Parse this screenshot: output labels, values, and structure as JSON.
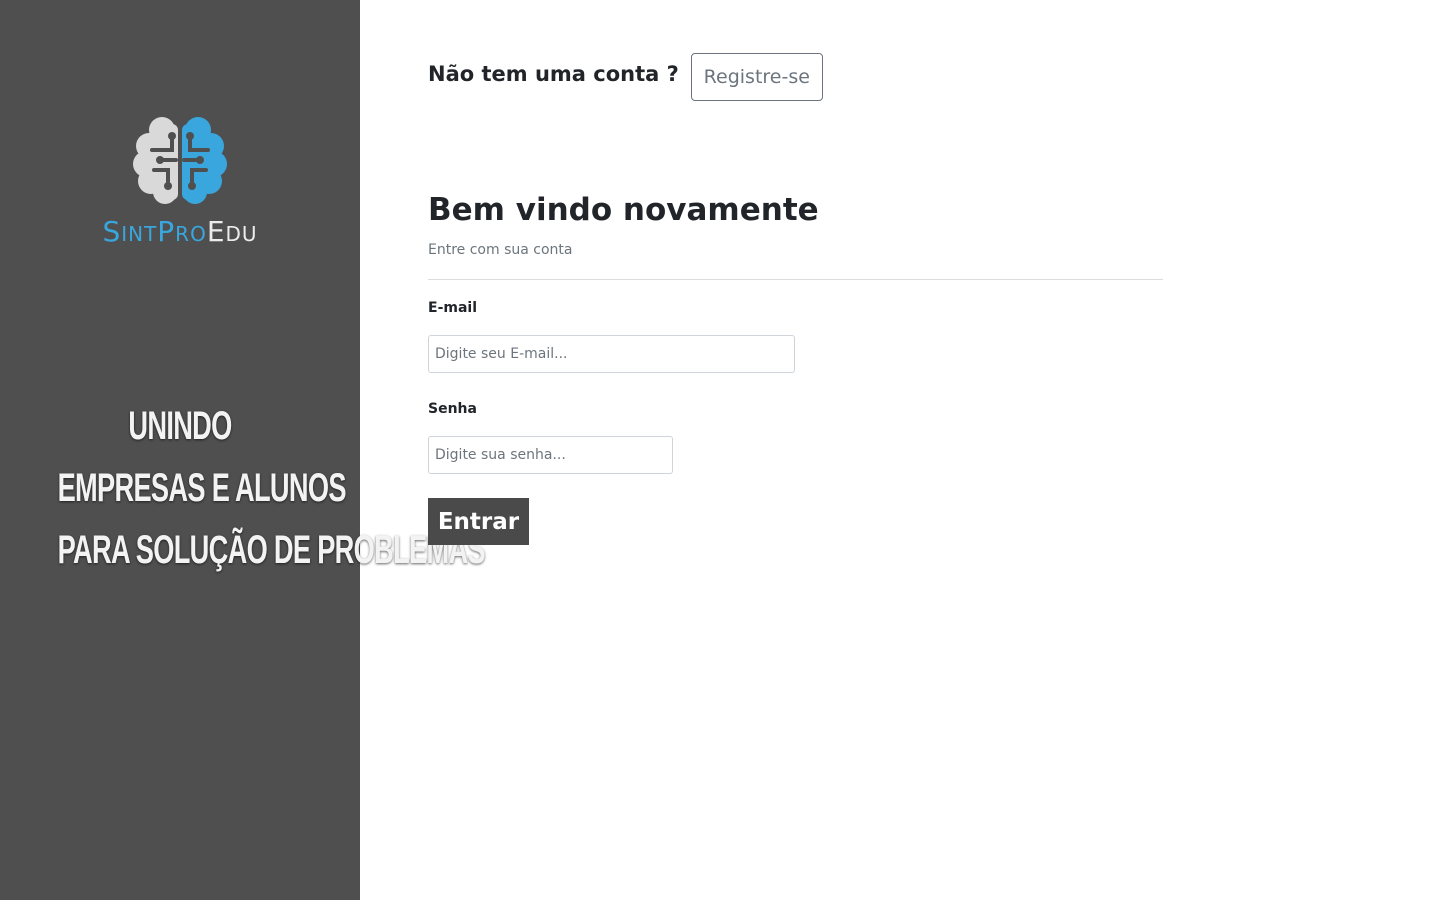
{
  "sidebar": {
    "logo_icon": "brain-circuit-icon",
    "brand_part_a": "SintPro",
    "brand_part_b": "Edu",
    "tagline": [
      "UNINDO",
      "EMPRESAS E ALUNOS",
      "PARA SOLUÇÃO DE PROBLEMAS"
    ]
  },
  "header": {
    "no_account": "Não tem uma conta ?",
    "register_label": "Registre-se"
  },
  "form": {
    "title": "Bem vindo novamente",
    "subtitle": "Entre com sua conta",
    "email": {
      "label": "E-mail",
      "placeholder": "Digite seu E-mail...",
      "value": ""
    },
    "password": {
      "label": "Senha",
      "placeholder": "Digite sua senha...",
      "value": ""
    },
    "submit_label": "Entrar"
  },
  "colors": {
    "sidebar_bg": "#4f4f4f",
    "brand_blue": "#39a6de",
    "brand_gray": "#d9d9d9",
    "submit_bg": "#4a4a4a"
  }
}
